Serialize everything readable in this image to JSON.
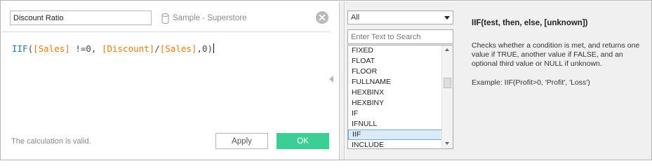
{
  "calc": {
    "name": "Discount Ratio",
    "datasource": "Sample - Superstore",
    "formula": {
      "fn": "IIF",
      "open": "(",
      "field1": "[Sales]",
      "op1": " !=0, ",
      "field2": "[Discount]",
      "slash": "/",
      "field3": "[Sales]",
      "tail": ",0)"
    },
    "status": "The calculation is valid.",
    "apply_label": "Apply",
    "ok_label": "OK"
  },
  "functions": {
    "category": "All",
    "search_placeholder": "Enter Text to Search",
    "items": [
      "FIXED",
      "FLOAT",
      "FLOOR",
      "FULLNAME",
      "HEXBINX",
      "HEXBINY",
      "IF",
      "IFNULL",
      "IIF",
      "INCLUDE"
    ],
    "selected": "IIF"
  },
  "help": {
    "signature": "IIF(test, then, else, [unknown])",
    "description": "Checks whether a condition is met, and returns one value if TRUE, another value if FALSE, and an optional third value or NULL if unknown.",
    "example": "Example: IIF(Profit>0, 'Profit', 'Loss')"
  },
  "colors": {
    "ok_button": "#3bcf95",
    "function_token": "#2b6ea8",
    "field_token": "#e07b1a",
    "selection": "#dce9f7"
  },
  "icons": {
    "datasource": "database-icon",
    "close": "close-icon",
    "splitter": "collapse-left-icon",
    "dropdown": "chevron-down-icon"
  }
}
